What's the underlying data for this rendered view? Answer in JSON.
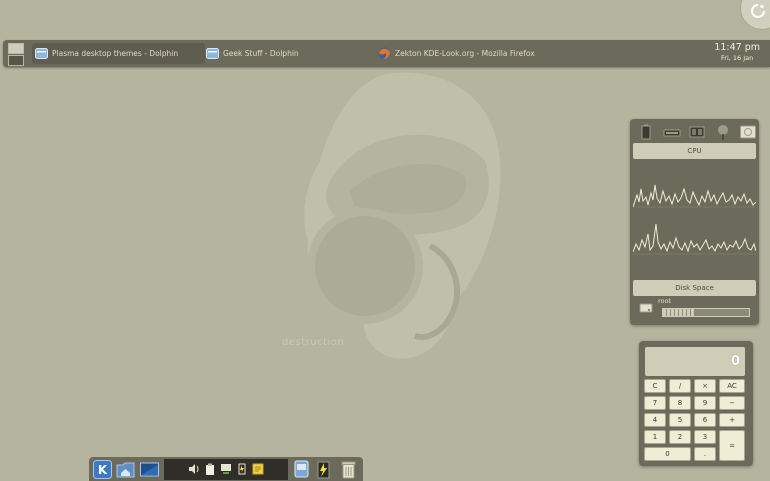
{
  "wallpaper": {
    "caption": "destruction"
  },
  "top_panel": {
    "tasks": [
      {
        "label": "Plasma desktop themes - Dolphin",
        "icon": "dolphin-icon"
      },
      {
        "label": "Geek Stuff - Dolphin",
        "icon": "dolphin-icon"
      },
      {
        "label": "Zekton KDE-Look.org - Mozilla Firefox",
        "icon": "firefox-icon"
      }
    ],
    "clock": {
      "time": "11:47 pm",
      "date": "Fri, 16 Jan"
    }
  },
  "system_monitor": {
    "cpu_header": "CPU",
    "disk_header": "Disk Space",
    "disk": {
      "label": "root",
      "used_fraction": 0.37
    }
  },
  "calculator": {
    "display": "0",
    "keys": [
      "C",
      "/",
      "×",
      "AC",
      "7",
      "8",
      "9",
      "−",
      "4",
      "5",
      "6",
      "+",
      "1",
      "2",
      "3",
      "=",
      "0",
      "."
    ]
  },
  "colors": {
    "panel": "#6b6a5b",
    "accent": "#cfcdb7",
    "desktop": "#b5b49e"
  }
}
